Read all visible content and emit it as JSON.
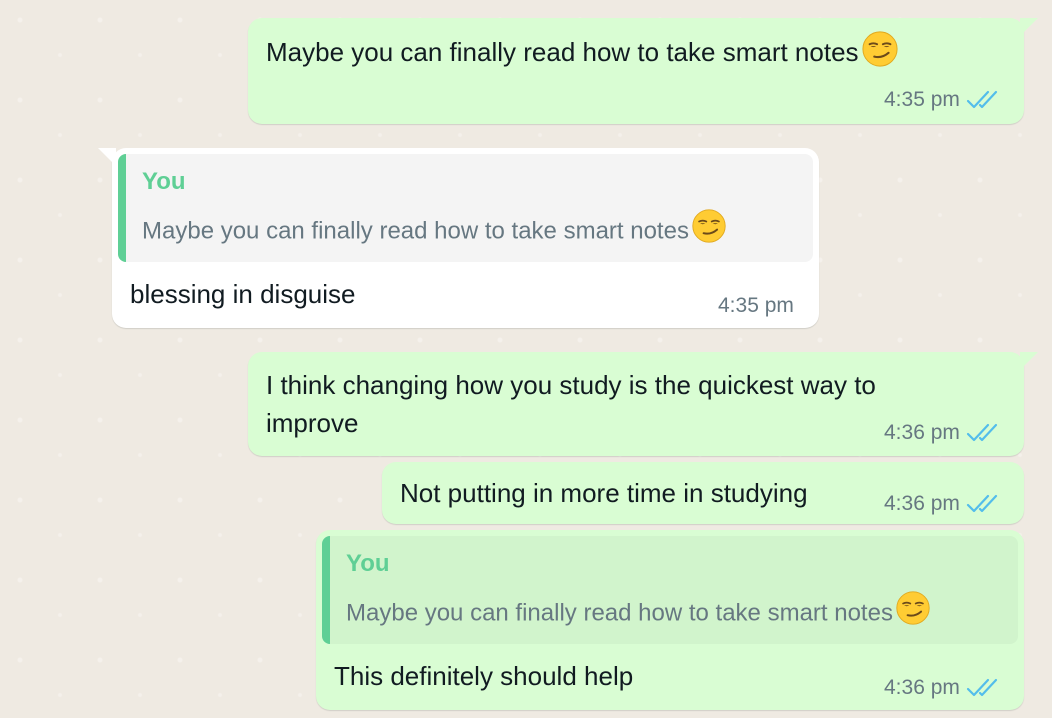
{
  "colors": {
    "wallpaper": "#efeae2",
    "outgoing_bubble": "#d9fdd3",
    "incoming_bubble": "#ffffff",
    "quote_bar": "#5fcf95",
    "quote_author": "#5fcf95",
    "read_ticks": "#53bdeb",
    "meta_text": "#667781"
  },
  "messages": [
    {
      "direction": "outgoing",
      "text": "Maybe you can finally read how to take smart notes",
      "emoji": "smirking-face-emoji",
      "time": "4:35 pm",
      "status": "read-ticks"
    },
    {
      "direction": "incoming",
      "quote": {
        "author": "You",
        "text": "Maybe you can finally read how to take smart notes",
        "emoji": "smirking-face-emoji"
      },
      "text": "blessing in disguise",
      "time": "4:35 pm"
    },
    {
      "direction": "outgoing",
      "text": "I think changing how you study is the quickest way to\nimprove",
      "time": "4:36 pm",
      "status": "read-ticks"
    },
    {
      "direction": "outgoing",
      "text": "Not putting in more time in studying",
      "time": "4:36 pm",
      "status": "read-ticks"
    },
    {
      "direction": "outgoing",
      "quote": {
        "author": "You",
        "text": "Maybe you can finally read how to take smart notes",
        "emoji": "smirking-face-emoji"
      },
      "text": "This definitely should help",
      "time": "4:36 pm",
      "status": "read-ticks"
    }
  ]
}
